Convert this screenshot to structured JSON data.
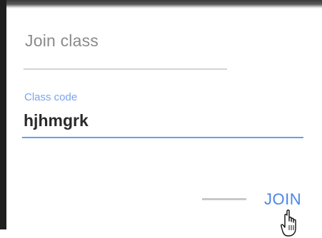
{
  "dialog": {
    "title": "Join class",
    "class_code_field": {
      "label": "Class code",
      "value": "hjhmgrk"
    },
    "actions": {
      "join_label": "JOIN"
    }
  },
  "colors": {
    "accent": "#4a86e8",
    "label": "#7aa3f0",
    "title_text": "#8a8a8a",
    "value_text": "#2a2a2a"
  },
  "icons": [
    "hand-pointer-cursor-icon"
  ]
}
